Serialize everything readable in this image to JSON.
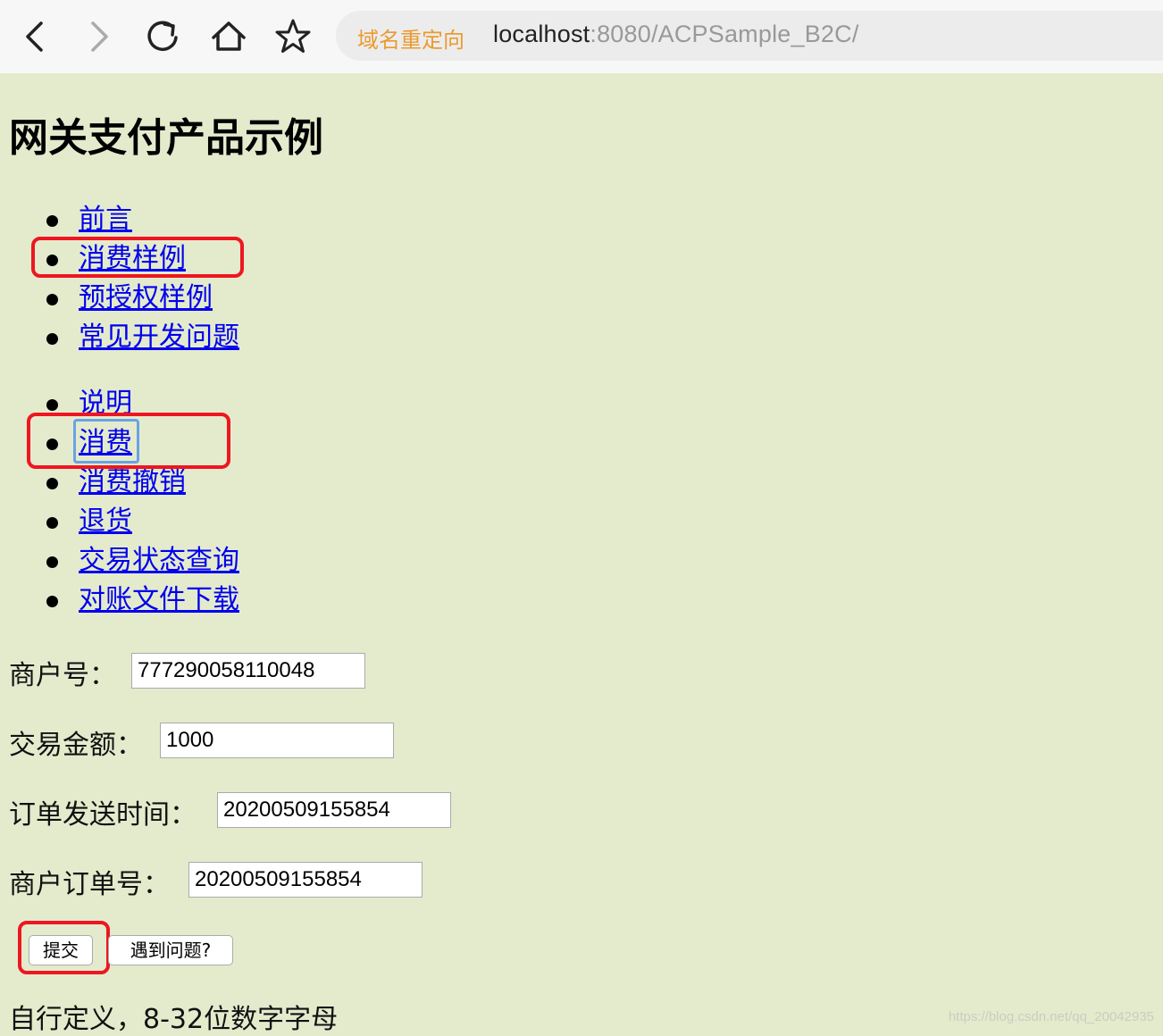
{
  "browser": {
    "redirect_tag": "域名重定向",
    "url_host": "localhost",
    "url_rest": ":8080/ACPSample_B2C/"
  },
  "page": {
    "title": "网关支付产品示例"
  },
  "menu_primary": [
    {
      "label": "前言"
    },
    {
      "label": "消费样例"
    },
    {
      "label": "预授权样例"
    },
    {
      "label": "常见开发问题"
    }
  ],
  "menu_secondary": [
    {
      "label": "说明"
    },
    {
      "label": "消费"
    },
    {
      "label": "消费撤销"
    },
    {
      "label": "退货"
    },
    {
      "label": "交易状态查询"
    },
    {
      "label": "对账文件下载"
    }
  ],
  "form": {
    "merchant_id": {
      "label": "商户号：",
      "value": "777290058110048"
    },
    "amount": {
      "label": "交易金额：",
      "value": "1000"
    },
    "order_time": {
      "label": "订单发送时间：",
      "value": "20200509155854"
    },
    "order_id": {
      "label": "商户订单号：",
      "value": "20200509155854"
    },
    "submit_label": "提交",
    "help_label": "遇到问题?"
  },
  "note": "自行定义，8-32位数字字母",
  "watermark": "https://blog.csdn.net/qq_20042935",
  "colors": {
    "background": "#e4ebcd",
    "link": "#0000ee",
    "highlight": "#ee1620",
    "redirect_tag": "#eb9a31"
  },
  "icons": [
    "back-icon",
    "forward-icon",
    "reload-icon",
    "home-icon",
    "bookmark-star-icon"
  ]
}
